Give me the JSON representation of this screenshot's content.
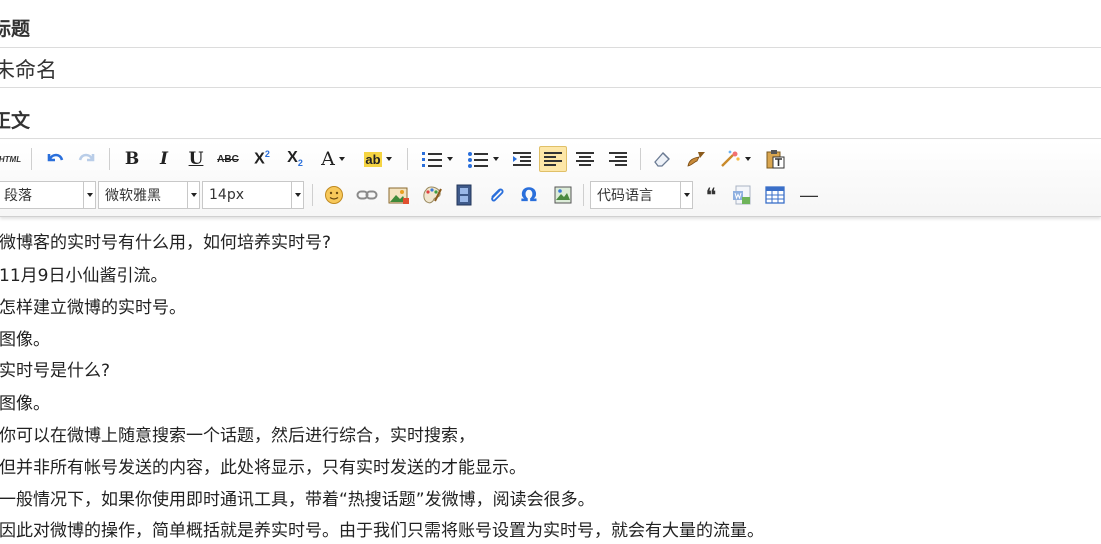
{
  "title_section": {
    "label": "标题",
    "value": "未命名"
  },
  "body_section": {
    "label": "正文"
  },
  "toolbar": {
    "html_label": "HTML",
    "bold": "B",
    "italic": "I",
    "underline": "U",
    "strike": "ABC",
    "superscript": "X",
    "sup_mark": "2",
    "subscript": "X",
    "sub_mark": "2",
    "font_color": "A",
    "highlight": "ab",
    "omega": "Ω",
    "quote": "❝",
    "hr_symbol": "—",
    "paragraph_select": "段落",
    "font_family_select": "微软雅黑",
    "font_size_select": "14px",
    "code_language_select": "代码语言"
  },
  "content": {
    "paragraphs": [
      "微博客的实时号有什么用，如何培养实时号?",
      "11月9日小仙酱引流。",
      "怎样建立微博的实时号。",
      "图像。",
      "实时号是什么?",
      "图像。",
      "你可以在微博上随意搜索一个话题，然后进行综合，实时搜索，",
      "但并非所有帐号发送的内容，此处将显示，只有实时发送的才能显示。",
      "一般情况下，如果你使用即时通讯工具，带着“热搜话题”发微博，阅读会很多。",
      "因此对微博的操作，简单概括就是养实时号。由于我们只需将账号设置为实时号，就会有大量的流量。"
    ]
  },
  "colors": {
    "accent_blue": "#2a6fdb",
    "active_bg": "#fde7a8"
  }
}
